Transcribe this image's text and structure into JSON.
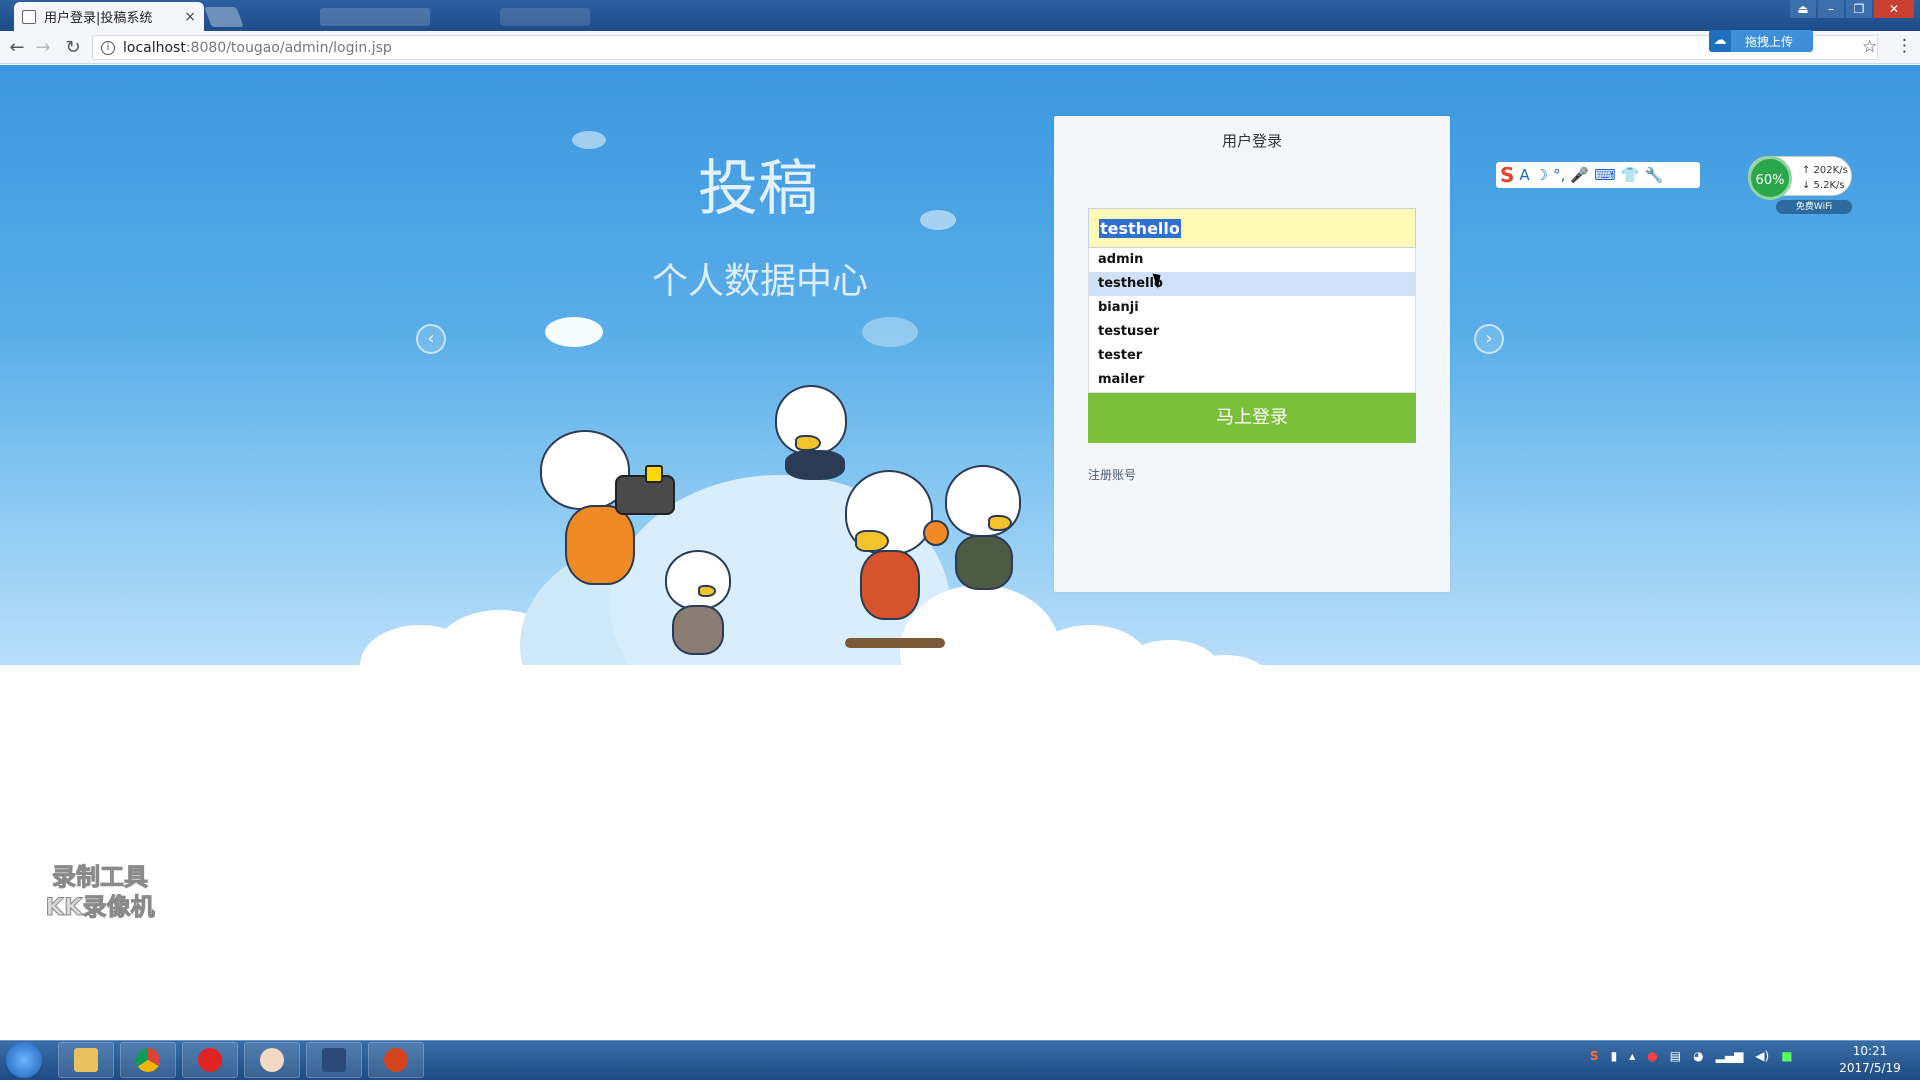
{
  "browser": {
    "tab_title": "用户登录|投稿系统",
    "tab_close": "×",
    "url_host": "localhost",
    "url_rest": ":8080/tougao/admin/login.jsp",
    "upload_label": "拖拽上传",
    "back": "←",
    "forward": "→",
    "reload": "↻",
    "star": "☆",
    "menu": "⋮"
  },
  "hero": {
    "title": "投稿",
    "subtitle": "个人数据中心",
    "prev_arrow": "‹",
    "next_arrow": "›"
  },
  "login": {
    "title": "用户登录",
    "username_value": "testhello",
    "suggestions": [
      "admin",
      "testhello",
      "bianji",
      "testuser",
      "tester",
      "mailer"
    ],
    "highlighted_index": 1,
    "submit_label": "马上登录",
    "register_label": "注册账号"
  },
  "overlay": {
    "ime_logo": "S",
    "ime_icons": [
      "A",
      "☽",
      "°,",
      "🎤",
      "⌨",
      "👕",
      "🔧"
    ],
    "net_percent": "60%",
    "net_up": "↑ 202K/s",
    "net_down": "↓ 5.2K/s",
    "net_wifi": "免费WiFi",
    "watermark_line1": "录制工具",
    "watermark_line2": "KK录像机"
  },
  "taskbar": {
    "clock_time": "10:21",
    "clock_date": "2017/5/19"
  },
  "colors": {
    "login_button": "#7cbf3b",
    "autofill": "#fbfbb6",
    "suggestion_highlight": "#cfe0f7",
    "hero_sky": "#3b97df"
  }
}
